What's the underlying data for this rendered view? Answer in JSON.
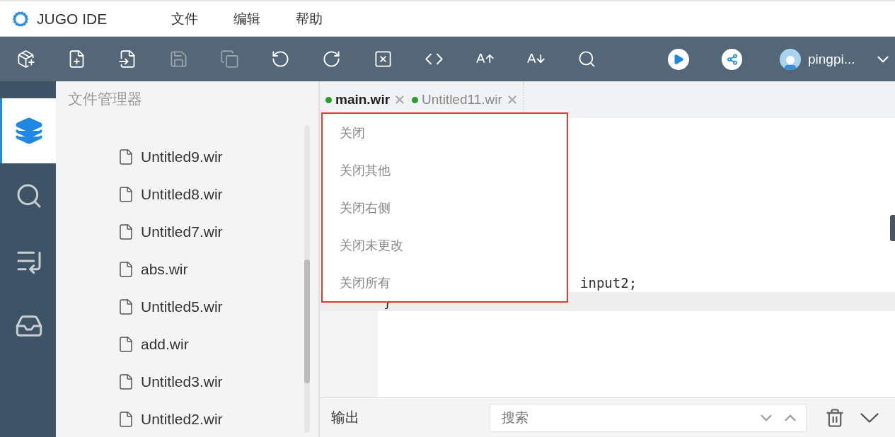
{
  "app": {
    "title": "JUGO IDE"
  },
  "menu": [
    "文件",
    "编辑",
    "帮助"
  ],
  "toolbar": {
    "buttons": [
      {
        "kind": "new-project",
        "disabled": false
      },
      {
        "kind": "new-file",
        "disabled": false
      },
      {
        "kind": "import",
        "disabled": false
      },
      {
        "kind": "save",
        "disabled": true
      },
      {
        "kind": "save-all",
        "disabled": true
      },
      {
        "kind": "undo",
        "disabled": false
      },
      {
        "kind": "redo",
        "disabled": false
      },
      {
        "kind": "close",
        "disabled": false
      },
      {
        "kind": "code",
        "disabled": false
      },
      {
        "kind": "font-up",
        "disabled": false
      },
      {
        "kind": "font-down",
        "disabled": false
      },
      {
        "kind": "search",
        "disabled": false
      }
    ],
    "actions": [
      {
        "kind": "run"
      },
      {
        "kind": "share"
      }
    ],
    "user": {
      "name": "pingpi..."
    }
  },
  "activity_bar": [
    {
      "kind": "files",
      "selected": true
    },
    {
      "kind": "search",
      "selected": false
    },
    {
      "kind": "deploy",
      "selected": false
    },
    {
      "kind": "inbox",
      "selected": false
    }
  ],
  "explorer": {
    "title": "文件管理器",
    "files": [
      "Untitled9.wir",
      "Untitled8.wir",
      "Untitled7.wir",
      "abs.wir",
      "Untitled5.wir",
      "add.wir",
      "Untitled3.wir",
      "Untitled2.wir"
    ]
  },
  "editor": {
    "tabs": [
      {
        "label": "main.wir",
        "selected": true,
        "modified": true
      },
      {
        "label": "Untitled11.wir",
        "selected": false,
        "modified": true
      }
    ],
    "lines": [
      {
        "text": "input2;",
        "highlighted": false
      },
      {
        "text": "}",
        "highlighted": true
      }
    ],
    "context_menu": [
      "关闭",
      "关闭其他",
      "关闭右侧",
      "关闭未更改",
      "关闭所有"
    ]
  },
  "output": {
    "title": "输出",
    "search": {
      "placeholder": "搜索"
    }
  }
}
